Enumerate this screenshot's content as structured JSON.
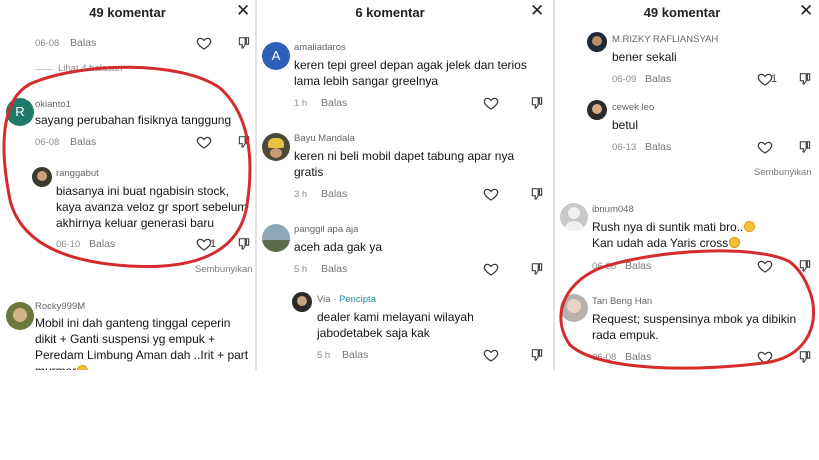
{
  "panels": [
    {
      "title": "49 komentar",
      "close_icon": "close-icon",
      "comments": [
        {
          "date": "06-08",
          "reply": "Balas"
        },
        {
          "more_replies": "Lihat 4 balasan"
        },
        {
          "user": "okianto1",
          "text": "sayang perubahan fisiknya tanggung",
          "date": "06-08",
          "reply": "Balas"
        },
        {
          "user": "ranggabut",
          "text": "biasanya ini buat ngabisin stock, kaya avanza veloz gr sport sebelum akhirnya keluar generasi baru",
          "date": "06-10",
          "reply": "Balas",
          "likes": "1",
          "hide": "Sembunyikan"
        },
        {
          "user": "Rocky999M",
          "text": "Mobil ini dah ganteng tinggal ceperin dikit + Ganti suspensi yg empuk + Peredam Limbung Aman dah ..Irit + part murmer"
        }
      ]
    },
    {
      "title": "6 komentar",
      "close_icon": "close-icon",
      "comments": [
        {
          "user": "amaliadaros",
          "avatar_letter": "A",
          "text": "keren tepi greel depan agak jelek dan terios lama lebih sangar greelnya",
          "date": "1 h",
          "reply": "Balas"
        },
        {
          "user": "Bayu Mandala",
          "text": "keren ni beli mobil dapet tabung apar nya gratis",
          "date": "3 h",
          "reply": "Balas"
        },
        {
          "user": "panggil apa aja",
          "text": "aceh ada gak ya",
          "date": "5 h",
          "reply": "Balas"
        },
        {
          "user": "Via",
          "author_badge": "· Pencipta",
          "text": "dealer kami melayani wilayah jabodetabek saja kak",
          "date": "5 h",
          "reply": "Balas"
        }
      ]
    },
    {
      "title": "49 komentar",
      "close_icon": "close-icon",
      "comments": [
        {
          "user": "M.RIZKY RAFLIANSYAH",
          "text": "bener sekali",
          "date": "06-09",
          "reply": "Balas",
          "likes": "1"
        },
        {
          "user": "cewek leo",
          "text": "betul",
          "date": "06-13",
          "reply": "Balas",
          "hide": "Sembunyikan"
        },
        {
          "user": "ibnum048",
          "text": "Rush nya di suntik mati bro..",
          "text2": "Kan udah ada Yaris cross",
          "date": "06-08",
          "reply": "Balas"
        },
        {
          "user": "Tan Beng Han",
          "text": "Request; suspensinya mbok ya dibikin rada empuk.",
          "date": "06-08",
          "reply": "Balas"
        }
      ]
    }
  ],
  "colors": {
    "annotation_red": "#d42c2c",
    "author_teal": "#1a8f9d",
    "avatar_okianto": "#1f7a6a",
    "avatar_amalia": "#2d5fb8"
  },
  "icons": [
    "close-icon",
    "heart-icon",
    "dislike-icon",
    "grinning-emoji-icon"
  ]
}
